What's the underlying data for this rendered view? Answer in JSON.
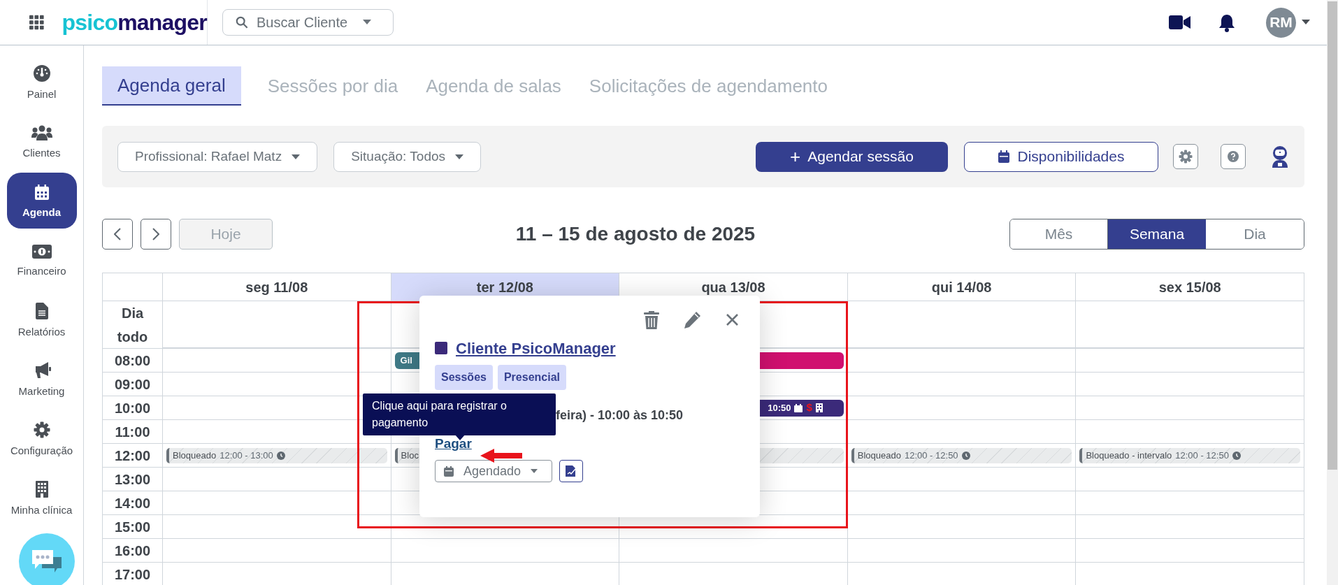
{
  "topbar": {
    "logo_part1": "psico",
    "logo_part2": "manager",
    "search": {
      "placeholder": "Buscar Cliente"
    },
    "avatar": "RM"
  },
  "sidebar": {
    "items": [
      {
        "label": "Painel",
        "selected": false
      },
      {
        "label": "Clientes",
        "selected": false
      },
      {
        "label": "Agenda",
        "selected": true
      },
      {
        "label": "Financeiro",
        "selected": false
      },
      {
        "label": "Relatórios",
        "selected": false
      },
      {
        "label": "Marketing",
        "selected": false
      },
      {
        "label": "Configuração",
        "selected": false
      },
      {
        "label": "Minha clínica",
        "selected": false
      }
    ]
  },
  "tabs": [
    {
      "label": "Agenda geral",
      "selected": true
    },
    {
      "label": "Sessões por dia",
      "selected": false
    },
    {
      "label": "Agenda de salas",
      "selected": false
    },
    {
      "label": "Solicitações de agendamento",
      "selected": false
    }
  ],
  "filters": [
    {
      "label": "Profissional: Rafael Matz"
    },
    {
      "label": "Situação: Todos"
    }
  ],
  "actions": {
    "primary_icon": "+",
    "primary": "Agendar sessão",
    "secondary": "Disponibilidades"
  },
  "nav": {
    "today": "Hoje",
    "today_disabled": true,
    "title": "11 – 15 de agosto de 2025"
  },
  "views": [
    {
      "label": "Mês",
      "selected": false
    },
    {
      "label": "Semana",
      "selected": true
    },
    {
      "label": "Dia",
      "selected": false
    }
  ],
  "calendar": {
    "allday_label": "Dia todo",
    "days": [
      {
        "label": "seg 11/08",
        "today": false
      },
      {
        "label": "ter 12/08",
        "today": true
      },
      {
        "label": "qua 13/08",
        "today": false
      },
      {
        "label": "qui 14/08",
        "today": false
      },
      {
        "label": "sex 15/08",
        "today": false
      }
    ],
    "rows": [
      {
        "time": "08:00",
        "cells": [
          {},
          {
            "event": {
              "kind": "session",
              "color": "#3f7a87",
              "text": "Gil"
            }
          },
          {
            "event": {
              "kind": "session",
              "color": "#d0106f"
            }
          },
          {},
          {}
        ]
      },
      {
        "time": "09:00",
        "cells": [
          {},
          {},
          {},
          {},
          {}
        ]
      },
      {
        "time": "10:00",
        "cells": [
          {},
          {},
          {
            "event": {
              "kind": "session",
              "color": "#3b2a7a",
              "text": "10:50",
              "payment_mark": "$"
            }
          },
          {},
          {}
        ]
      },
      {
        "time": "11:00",
        "cells": [
          {},
          {},
          {},
          {},
          {}
        ]
      },
      {
        "time": "12:00",
        "cells": [
          {
            "event": {
              "kind": "blocked",
              "title": "Bloqueado",
              "time": "12:00 - 13:00"
            }
          },
          {
            "event": {
              "kind": "blocked",
              "title": "Bloc"
            }
          },
          {
            "event": {
              "kind": "blocked"
            }
          },
          {
            "event": {
              "kind": "blocked",
              "title": "Bloqueado",
              "time": "12:00 - 12:50"
            }
          },
          {
            "event": {
              "kind": "blocked",
              "title": "Bloqueado - intervalo",
              "time": "12:00 - 12:50"
            }
          }
        ]
      },
      {
        "time": "13:00",
        "cells": [
          {},
          {},
          {},
          {},
          {}
        ]
      },
      {
        "time": "14:00",
        "cells": [
          {},
          {},
          {},
          {},
          {}
        ]
      },
      {
        "time": "15:00",
        "cells": [
          {},
          {},
          {},
          {},
          {}
        ]
      },
      {
        "time": "16:00",
        "cells": [
          {},
          {},
          {},
          {},
          {}
        ]
      },
      {
        "time": "17:00",
        "cells": [
          {},
          {},
          {},
          {},
          {}
        ]
      }
    ]
  },
  "popup": {
    "color": "#3b2a7a",
    "client": "Cliente PsicoManager",
    "tags": [
      "Sessões",
      "Presencial"
    ],
    "schedule": "feira) - 10:00 às 10:50",
    "pay_link": "Pagar",
    "status": "Agendado"
  },
  "tooltip": {
    "text": "Clique aqui para registrar o pagamento"
  }
}
